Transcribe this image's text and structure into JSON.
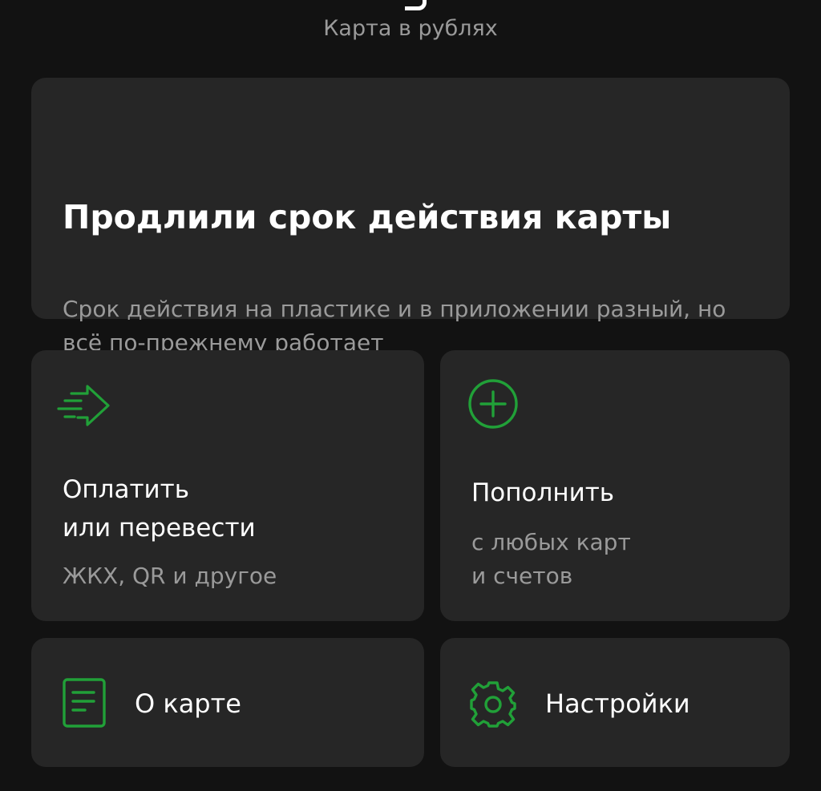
{
  "header": {
    "subtitle": "Карта в рублях"
  },
  "banner": {
    "title": "Продлили срок действия карты",
    "text": "Срок действия на пластике и в приложении разный, но всё по-прежнему работает"
  },
  "actions": {
    "pay": {
      "title_line1": "Оплатить",
      "title_line2": "или перевести",
      "subtitle": "ЖКХ, QR и другое",
      "icon": "transfer-arrow-icon"
    },
    "topup": {
      "title": "Пополнить",
      "subtitle_line1": "с любых карт",
      "subtitle_line2": "и счетов",
      "icon": "plus-circle-icon"
    },
    "about": {
      "label": "О карте",
      "icon": "document-icon"
    },
    "settings": {
      "label": "Настройки",
      "icon": "gear-icon"
    }
  },
  "colors": {
    "background": "#121212",
    "card": "#262626",
    "accent": "#21a038",
    "secondary_text": "#9a9a9a"
  }
}
